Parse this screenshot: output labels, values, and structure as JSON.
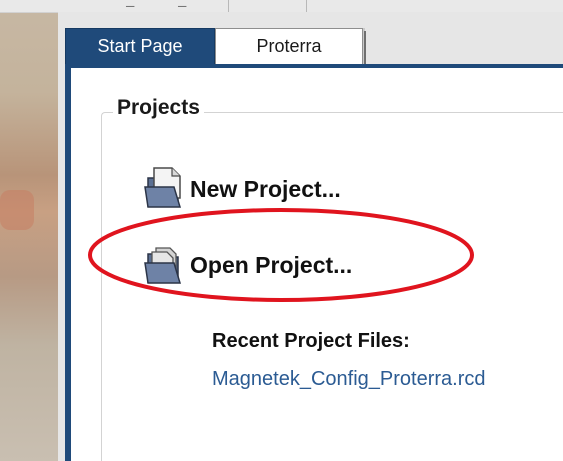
{
  "tabs": [
    {
      "label": "Start Page",
      "active": true
    },
    {
      "label": "Proterra",
      "active": false
    }
  ],
  "projects": {
    "heading": "Projects",
    "new_project_label": "New Project...",
    "open_project_label": "Open Project...",
    "recent_heading": "Recent Project Files:",
    "recent_files": [
      "Magnetek_Config_Proterra.rcd"
    ]
  },
  "icons": {
    "new_project": "new-folder-icon",
    "open_project": "open-folder-icon"
  },
  "colors": {
    "tab_active_bg": "#1f4a7a",
    "link": "#2b5b93",
    "annotation": "#e0141e"
  }
}
